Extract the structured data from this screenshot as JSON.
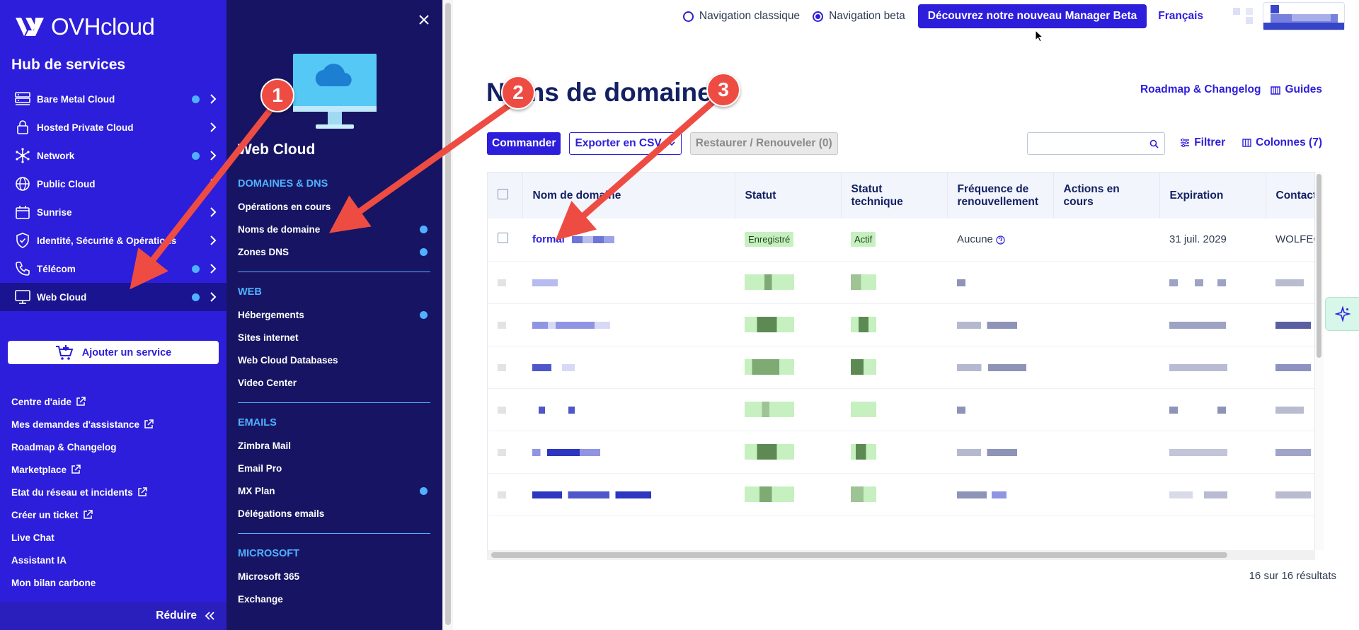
{
  "sidebar": {
    "logo": "OVHcloud",
    "hub_title": "Hub de services",
    "items": [
      {
        "label": "Bare Metal Cloud",
        "icon": "server-icon",
        "dot": true
      },
      {
        "label": "Hosted Private Cloud",
        "icon": "lock-icon",
        "dot": false
      },
      {
        "label": "Network",
        "icon": "network-icon",
        "dot": true
      },
      {
        "label": "Public Cloud",
        "icon": "globe-icon",
        "dot": false
      },
      {
        "label": "Sunrise",
        "icon": "calendar-icon",
        "dot": false
      },
      {
        "label": "Identité, Sécurité & Opérations",
        "icon": "shield-icon",
        "dot": false
      },
      {
        "label": "Télécom",
        "icon": "phone-icon",
        "dot": true
      },
      {
        "label": "Web Cloud",
        "icon": "monitor-icon",
        "dot": true,
        "active": true
      }
    ],
    "add_service": "Ajouter un service",
    "links": [
      {
        "label": "Centre d'aide",
        "external": true
      },
      {
        "label": "Mes demandes d'assistance",
        "external": true
      },
      {
        "label": "Roadmap & Changelog",
        "external": false
      },
      {
        "label": "Marketplace",
        "external": true
      },
      {
        "label": "Etat du réseau et incidents",
        "external": true
      },
      {
        "label": "Créer un ticket",
        "external": true
      },
      {
        "label": "Live Chat",
        "external": false
      },
      {
        "label": "Assistant IA",
        "external": false
      },
      {
        "label": "Mon bilan carbone",
        "external": false
      }
    ],
    "reduce": "Réduire"
  },
  "submenu": {
    "title": "Web Cloud",
    "sections": [
      {
        "heading": "DOMAINES & DNS",
        "items": [
          {
            "label": "Opérations en cours",
            "dot": false
          },
          {
            "label": "Noms de domaine",
            "dot": true
          },
          {
            "label": "Zones DNS",
            "dot": true
          }
        ]
      },
      {
        "heading": "WEB",
        "items": [
          {
            "label": "Hébergements",
            "dot": true
          },
          {
            "label": "Sites internet",
            "dot": false
          },
          {
            "label": "Web Cloud Databases",
            "dot": false
          },
          {
            "label": "Video Center",
            "dot": false
          }
        ]
      },
      {
        "heading": "EMAILS",
        "items": [
          {
            "label": "Zimbra Mail",
            "dot": false
          },
          {
            "label": "Email Pro",
            "dot": false
          },
          {
            "label": "MX Plan",
            "dot": true
          },
          {
            "label": "Délégations emails",
            "dot": false
          }
        ]
      },
      {
        "heading": "MICROSOFT",
        "items": [
          {
            "label": "Microsoft 365",
            "dot": false
          },
          {
            "label": "Exchange",
            "dot": false
          }
        ]
      }
    ]
  },
  "topbar": {
    "nav_classic": "Navigation classique",
    "nav_beta": "Navigation beta",
    "beta_button": "Découvrez notre nouveau Manager Beta",
    "language": "Français"
  },
  "main": {
    "title": "Noms de domaine",
    "roadmap_link": "Roadmap & Changelog",
    "guides_link": "Guides",
    "order_button": "Commander",
    "export_button": "Exporter en CSV",
    "restore_button": "Restaurer / Renouveler (0)",
    "search_placeholder": "",
    "filter_link": "Filtrer",
    "columns_link": "Colonnes (7)",
    "columns": [
      "Nom de domaine",
      "Statut",
      "Statut technique",
      "Fréquence de renouvellement",
      "Actions en cours",
      "Expiration",
      "Contact"
    ],
    "first_row": {
      "domain": "formal",
      "status": "Enregistré",
      "tech_status": "Actif",
      "renewal": "Aucune",
      "actions": "",
      "expiration": "31 juil. 2029",
      "contact": "WOLFEC"
    },
    "results": "16 sur 16 résultats"
  },
  "callouts": [
    "1",
    "2",
    "3"
  ],
  "colors": {
    "brand": "#2d1edb",
    "submenu_bg": "#171563",
    "accent_dot": "#4fb1ff",
    "callout": "#ee4c43",
    "badge": "#c6f0c0"
  }
}
